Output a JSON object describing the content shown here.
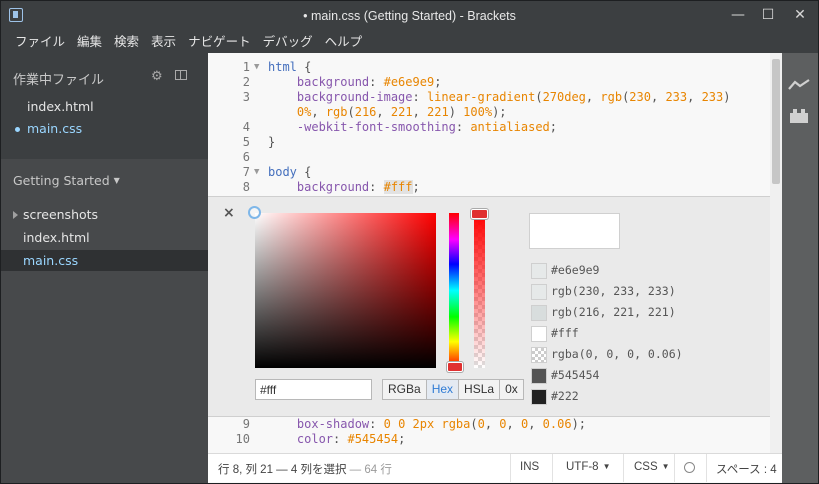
{
  "window": {
    "title": "• main.css (Getting Started) - Brackets",
    "minimize": "—",
    "maximize": "☐",
    "close": "✕"
  },
  "menu": [
    "ファイル",
    "編集",
    "検索",
    "表示",
    "ナビゲート",
    "デバッグ",
    "ヘルプ"
  ],
  "sidebar": {
    "working_files_heading": "作業中ファイル",
    "working_files": [
      {
        "label": "index.html",
        "active": false
      },
      {
        "label": "main.css",
        "active": true
      }
    ],
    "project_title": "Getting Started",
    "tree": [
      {
        "label": "screenshots",
        "type": "folder"
      },
      {
        "label": "index.html",
        "type": "file"
      },
      {
        "label": "main.css",
        "type": "file",
        "selected": true
      }
    ]
  },
  "editor": {
    "lines_top": [
      {
        "n": "1",
        "fold": true,
        "segs": [
          [
            "sel",
            "html"
          ],
          [
            "p",
            " {"
          ]
        ]
      },
      {
        "n": "2",
        "fold": false,
        "segs": [
          [
            "p",
            "    "
          ],
          [
            "prop",
            "background"
          ],
          [
            "p",
            ": "
          ],
          [
            "val",
            "#e6e9e9"
          ],
          [
            "p",
            ";"
          ]
        ]
      },
      {
        "n": "3",
        "fold": false,
        "segs": [
          [
            "p",
            "    "
          ],
          [
            "prop",
            "background-image"
          ],
          [
            "p",
            ": "
          ],
          [
            "val",
            "linear-gradient"
          ],
          [
            "p",
            "("
          ],
          [
            "val",
            "270deg"
          ],
          [
            "p",
            ", "
          ],
          [
            "val",
            "rgb"
          ],
          [
            "p",
            "("
          ],
          [
            "val",
            "230"
          ],
          [
            "p",
            ", "
          ],
          [
            "val",
            "233"
          ],
          [
            "p",
            ", "
          ],
          [
            "val",
            "233"
          ],
          [
            "p",
            ")"
          ]
        ]
      },
      {
        "n": "",
        "fold": false,
        "segs": [
          [
            "p",
            "    "
          ],
          [
            "val",
            "0%"
          ],
          [
            "p",
            ", "
          ],
          [
            "val",
            "rgb"
          ],
          [
            "p",
            "("
          ],
          [
            "val",
            "216"
          ],
          [
            "p",
            ", "
          ],
          [
            "val",
            "221"
          ],
          [
            "p",
            ", "
          ],
          [
            "val",
            "221"
          ],
          [
            "p",
            ") "
          ],
          [
            "val",
            "100%"
          ],
          [
            "p",
            ");"
          ]
        ]
      },
      {
        "n": "4",
        "fold": false,
        "segs": [
          [
            "p",
            "    "
          ],
          [
            "prop",
            "-webkit-font-smoothing"
          ],
          [
            "p",
            ": "
          ],
          [
            "val",
            "antialiased"
          ],
          [
            "p",
            ";"
          ]
        ]
      },
      {
        "n": "5",
        "fold": false,
        "segs": [
          [
            "p",
            "}"
          ]
        ]
      },
      {
        "n": "6",
        "fold": false,
        "segs": [
          [
            "p",
            ""
          ]
        ]
      },
      {
        "n": "7",
        "fold": true,
        "segs": [
          [
            "sel",
            "body"
          ],
          [
            "p",
            " {"
          ]
        ]
      },
      {
        "n": "8",
        "fold": false,
        "segs": [
          [
            "p",
            "    "
          ],
          [
            "prop",
            "background"
          ],
          [
            "p",
            ": "
          ],
          [
            "hl",
            "#fff"
          ],
          [
            "p",
            ";"
          ]
        ]
      }
    ],
    "lines_bottom": [
      {
        "n": "9",
        "fold": false,
        "segs": [
          [
            "p",
            "    "
          ],
          [
            "prop",
            "box-shadow"
          ],
          [
            "p",
            ": "
          ],
          [
            "val",
            "0"
          ],
          [
            "p",
            " "
          ],
          [
            "val",
            "0"
          ],
          [
            "p",
            " "
          ],
          [
            "val",
            "2px"
          ],
          [
            "p",
            " "
          ],
          [
            "val",
            "rgba"
          ],
          [
            "p",
            "("
          ],
          [
            "val",
            "0"
          ],
          [
            "p",
            ", "
          ],
          [
            "val",
            "0"
          ],
          [
            "p",
            ", "
          ],
          [
            "val",
            "0"
          ],
          [
            "p",
            ", "
          ],
          [
            "val",
            "0.06"
          ],
          [
            "p",
            ");"
          ]
        ]
      },
      {
        "n": "10",
        "fold": false,
        "segs": [
          [
            "p",
            "    "
          ],
          [
            "prop",
            "color"
          ],
          [
            "p",
            ": "
          ],
          [
            "val",
            "#545454"
          ],
          [
            "p",
            ";"
          ]
        ]
      }
    ]
  },
  "color_editor": {
    "close": "×",
    "hex_value": "#fff",
    "formats": [
      {
        "label": "RGBa",
        "active": false
      },
      {
        "label": "Hex",
        "active": true
      },
      {
        "label": "HSLa",
        "active": false
      },
      {
        "label": "0x",
        "active": false
      }
    ],
    "preview_color": "#ffffff",
    "swatches": [
      {
        "label": "#e6e9e9",
        "color": "#e6e9e9"
      },
      {
        "label": "rgb(230, 233, 233)",
        "color": "#e6e9e9"
      },
      {
        "label": "rgb(216, 221, 221)",
        "color": "#d8dddd"
      },
      {
        "label": "#fff",
        "color": "#ffffff"
      },
      {
        "label": "rgba(0, 0, 0, 0.06)",
        "color": "checker"
      },
      {
        "label": "#545454",
        "color": "#545454"
      },
      {
        "label": "#222",
        "color": "#222222"
      }
    ]
  },
  "status": {
    "position": "行 8, 列 21 — 4 列を選択",
    "line_count": "— 64 行",
    "ins": "INS",
    "encoding": "UTF-8",
    "language": "CSS",
    "indent": "スペース : 4"
  },
  "colors": {
    "selector": "#446fbd",
    "property": "#8757ad",
    "value": "#e88501",
    "active_file": "#9ad6ff"
  }
}
